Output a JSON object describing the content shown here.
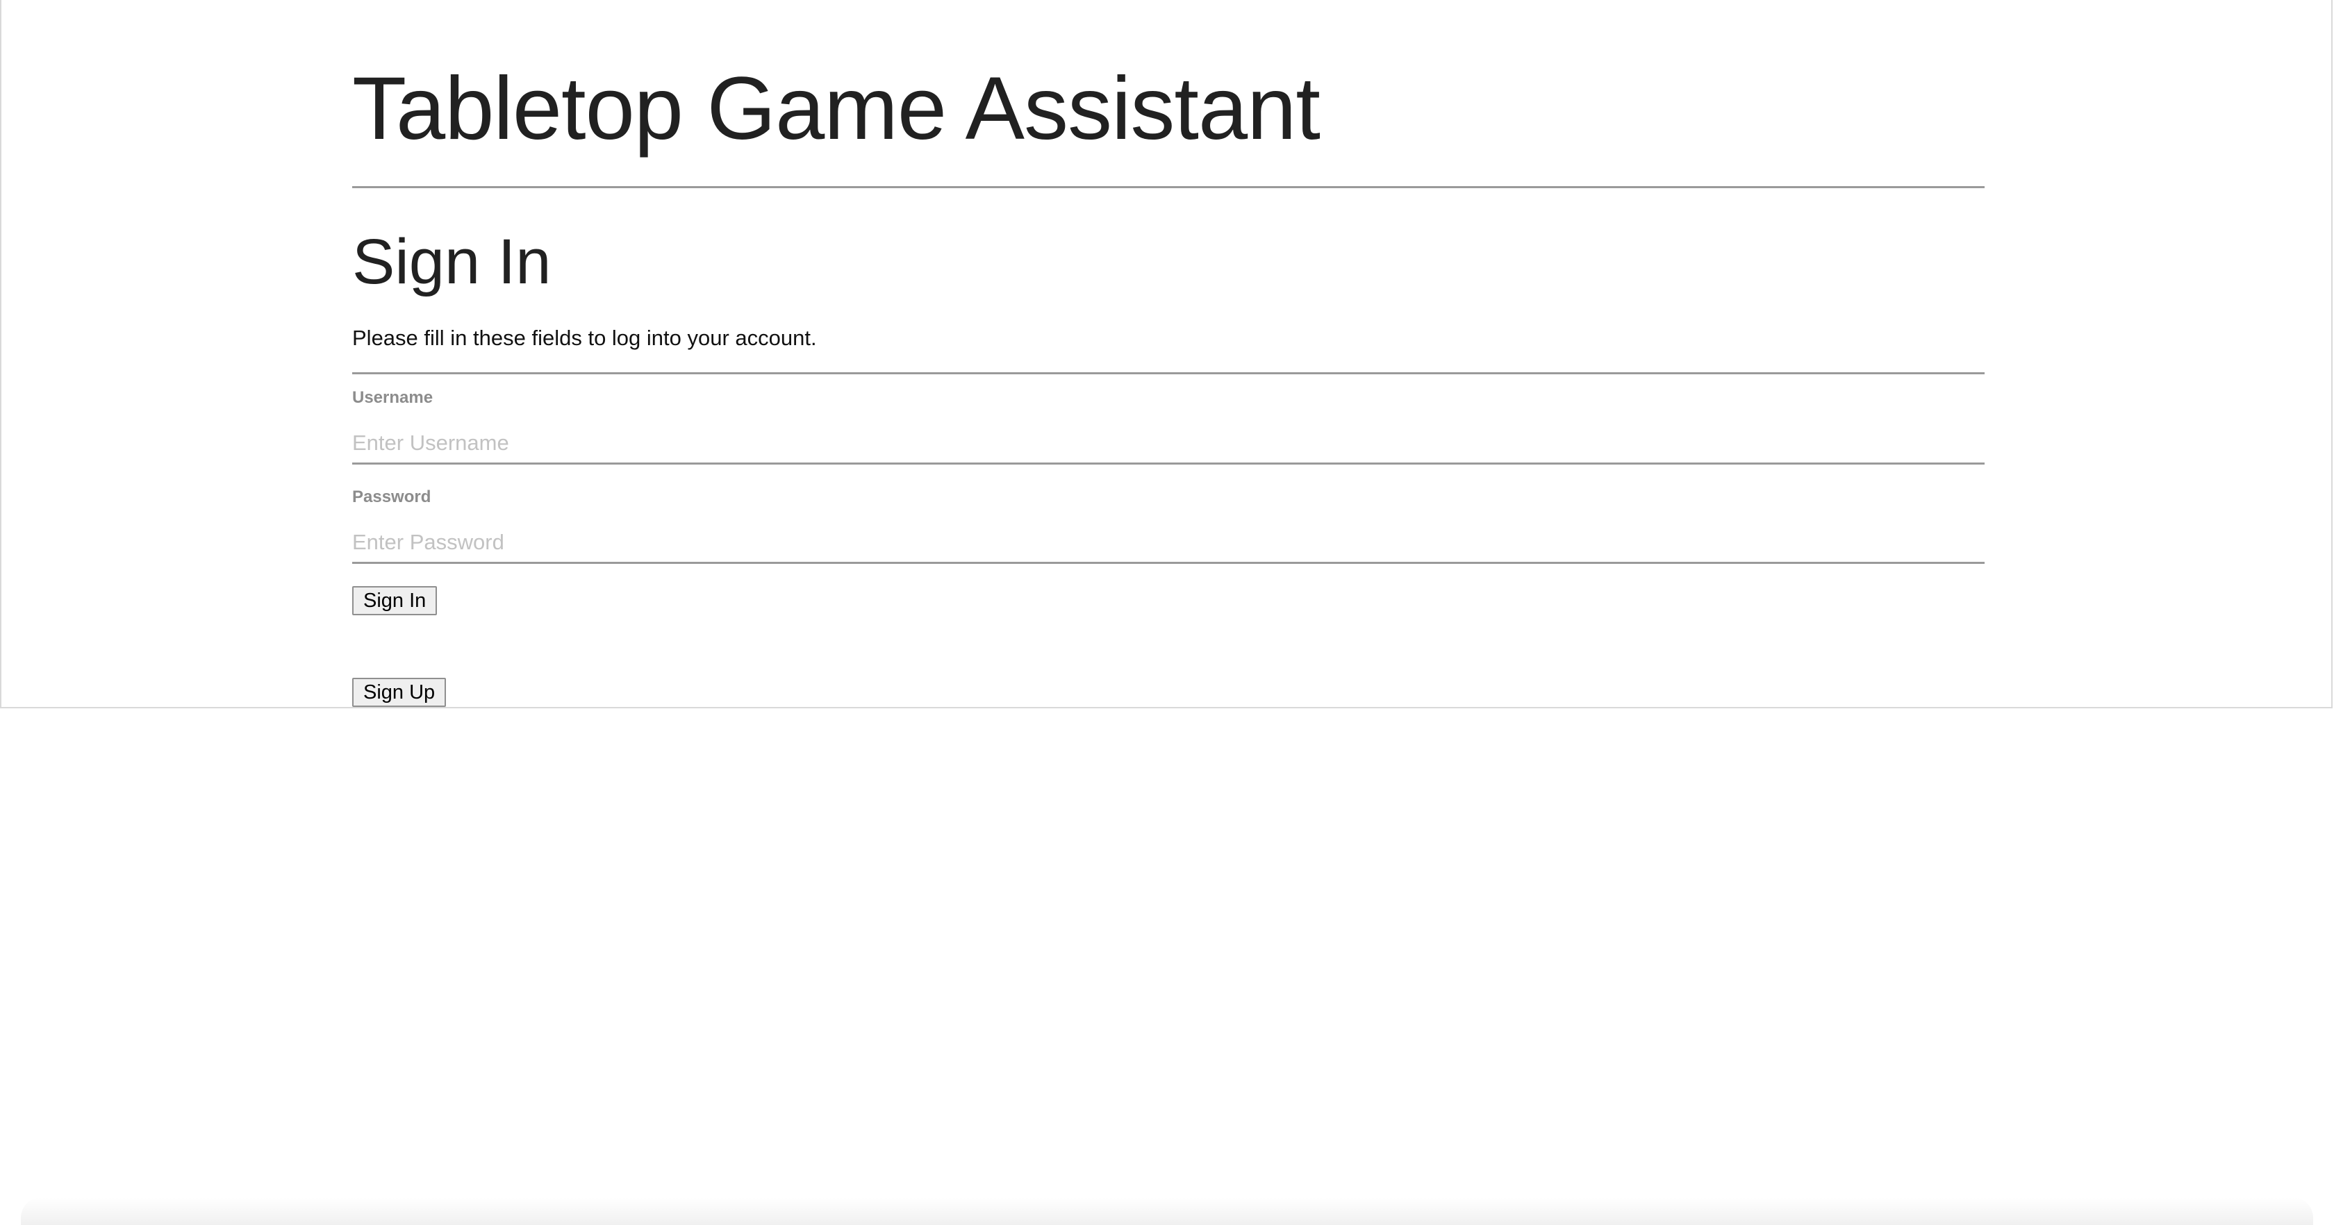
{
  "header": {
    "app_title": "Tabletop Game Assistant"
  },
  "signin": {
    "heading": "Sign In",
    "intro": "Please fill in these fields to log into your account.",
    "username": {
      "label": "Username",
      "placeholder": "Enter Username",
      "value": ""
    },
    "password": {
      "label": "Password",
      "placeholder": "Enter Password",
      "value": ""
    },
    "submit_label": "Sign In",
    "signup_label": "Sign Up"
  },
  "colors": {
    "text": "#212121",
    "label": "#8c8c8c",
    "placeholder": "#c2c2c2",
    "rule": "#9a9a9a",
    "button_bg": "#efefef",
    "button_border": "#8f8f8f"
  }
}
